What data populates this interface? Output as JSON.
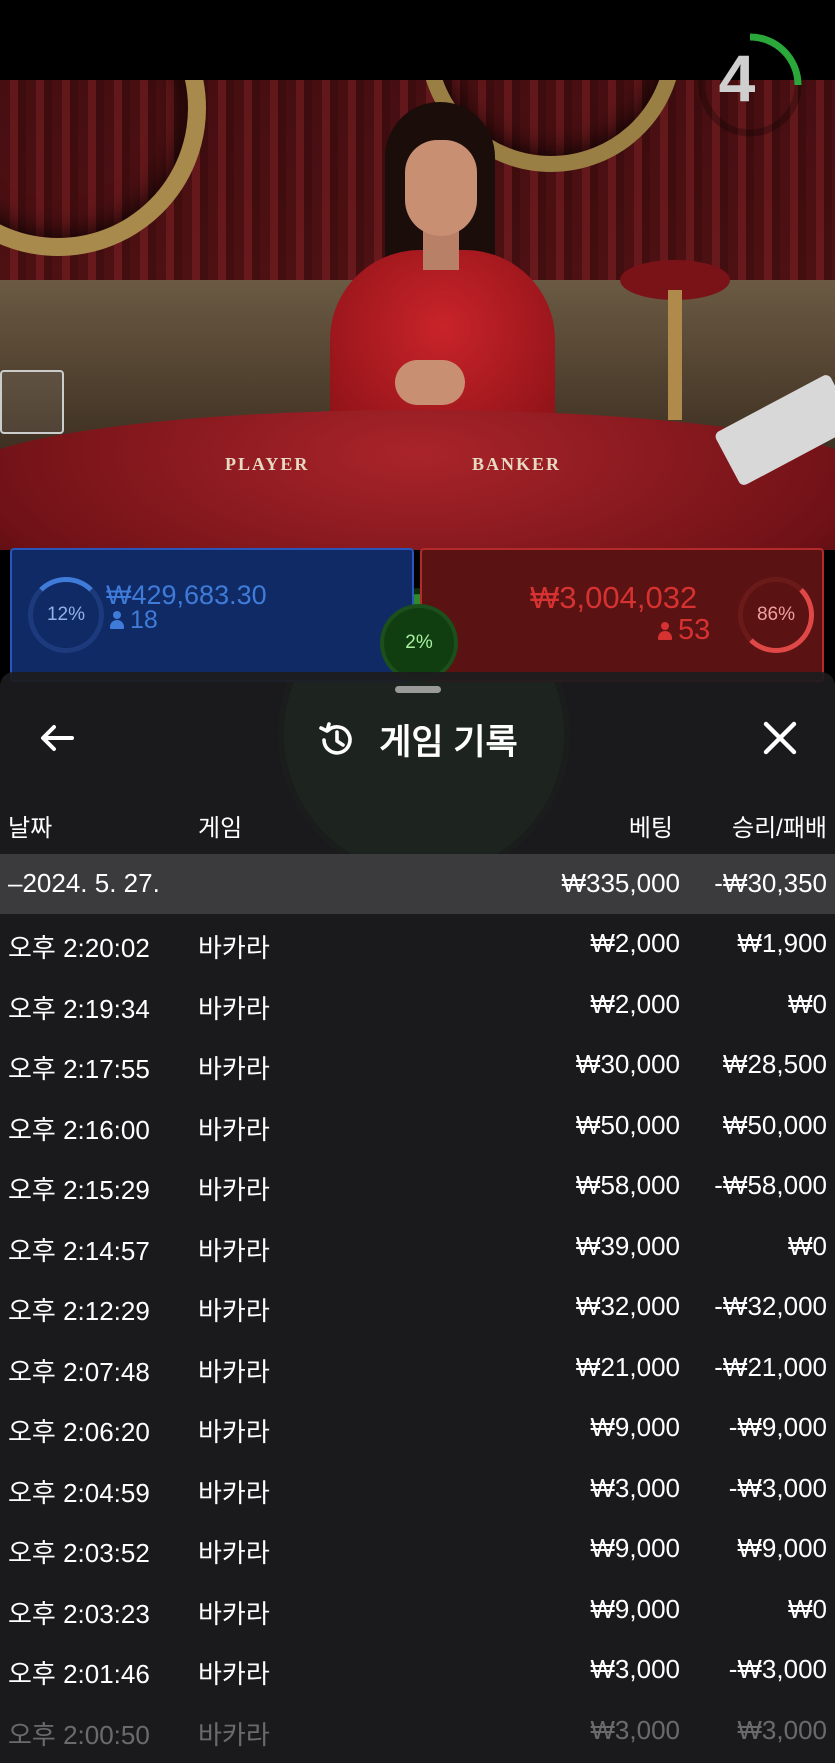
{
  "video": {
    "table_player_label": "PLAYER",
    "table_banker_label": "BANKER",
    "countdown": "4"
  },
  "bets": {
    "player": {
      "percent": "12%",
      "amount": "₩429,683.30",
      "players": "18"
    },
    "tie": {
      "percent": "2%"
    },
    "banker": {
      "percent": "86%",
      "amount": "₩3,004,032",
      "players": "53"
    }
  },
  "panel": {
    "title": "게임 기록",
    "columns": {
      "date": "날짜",
      "game": "게임",
      "bet": "베팅",
      "result": "승리/패배"
    },
    "date_group": {
      "label": "–2024. 5. 27.",
      "bet_total": "₩335,000",
      "result_total": "-₩30,350"
    },
    "rows": [
      {
        "time": "오후 2:20:02",
        "game": "바카라",
        "bet": "₩2,000",
        "result": "₩1,900"
      },
      {
        "time": "오후 2:19:34",
        "game": "바카라",
        "bet": "₩2,000",
        "result": "₩0"
      },
      {
        "time": "오후 2:17:55",
        "game": "바카라",
        "bet": "₩30,000",
        "result": "₩28,500"
      },
      {
        "time": "오후 2:16:00",
        "game": "바카라",
        "bet": "₩50,000",
        "result": "₩50,000"
      },
      {
        "time": "오후 2:15:29",
        "game": "바카라",
        "bet": "₩58,000",
        "result": "-₩58,000"
      },
      {
        "time": "오후 2:14:57",
        "game": "바카라",
        "bet": "₩39,000",
        "result": "₩0"
      },
      {
        "time": "오후 2:12:29",
        "game": "바카라",
        "bet": "₩32,000",
        "result": "-₩32,000"
      },
      {
        "time": "오후 2:07:48",
        "game": "바카라",
        "bet": "₩21,000",
        "result": "-₩21,000"
      },
      {
        "time": "오후 2:06:20",
        "game": "바카라",
        "bet": "₩9,000",
        "result": "-₩9,000"
      },
      {
        "time": "오후 2:04:59",
        "game": "바카라",
        "bet": "₩3,000",
        "result": "-₩3,000"
      },
      {
        "time": "오후 2:03:52",
        "game": "바카라",
        "bet": "₩9,000",
        "result": "₩9,000"
      },
      {
        "time": "오후 2:03:23",
        "game": "바카라",
        "bet": "₩9,000",
        "result": "₩0"
      },
      {
        "time": "오후 2:01:46",
        "game": "바카라",
        "bet": "₩3,000",
        "result": "-₩3,000"
      }
    ],
    "partial_row": {
      "time": "오후 2:00:50",
      "game": "바카라",
      "bet": "₩3,000",
      "result": "₩3,000"
    }
  },
  "colors": {
    "player_blue": "#3f7bd8",
    "banker_red": "#d63232",
    "tie_green": "#2e8a2a",
    "panel_bg": "#1c1c1e",
    "date_row_bg": "#3b3b3d"
  }
}
